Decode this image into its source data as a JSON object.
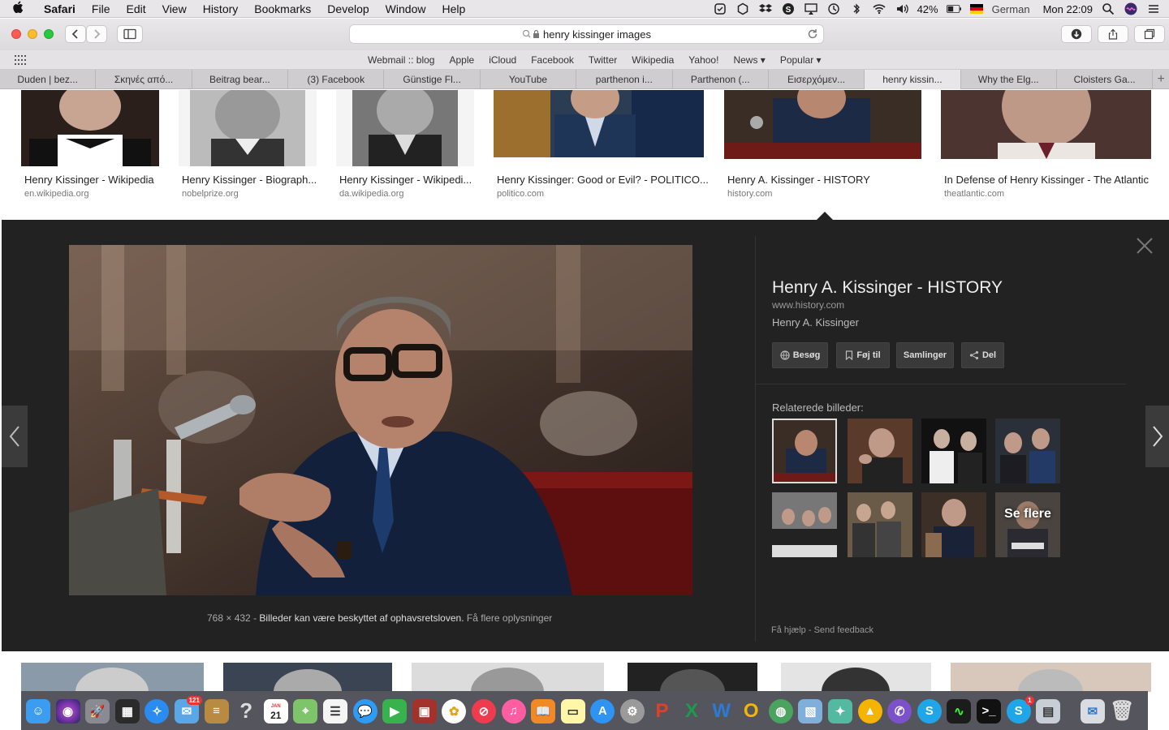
{
  "menubar": {
    "app": "Safari",
    "menus": [
      "File",
      "Edit",
      "View",
      "History",
      "Bookmarks",
      "Develop",
      "Window",
      "Help"
    ],
    "battery": "42%",
    "input_language": "German",
    "clock": "Mon 22:09"
  },
  "toolbar": {
    "address": "henry kissinger images"
  },
  "favorites": [
    "Webmail :: blog",
    "Apple",
    "iCloud",
    "Facebook",
    "Twitter",
    "Wikipedia",
    "Yahoo!",
    "News ▾",
    "Popular ▾"
  ],
  "tabs": [
    "Duden | bez...",
    "Σκηνές από...",
    "Beitrag bear...",
    "(3) Facebook",
    "Günstige Fl...",
    "YouTube",
    "parthenon i...",
    "Parthenon (...",
    "Εισερχόμεν...",
    "henry kissin...",
    "Why the Elg...",
    "Cloisters Ga..."
  ],
  "active_tab_index": 9,
  "results_top": [
    {
      "title": "Henry Kissinger - Wikipedia",
      "source": "en.wikipedia.org"
    },
    {
      "title": "Henry Kissinger - Biograph...",
      "source": "nobelprize.org"
    },
    {
      "title": "Henry Kissinger - Wikipedi...",
      "source": "da.wikipedia.org"
    },
    {
      "title": "Henry Kissinger: Good or Evil? - POLITICO...",
      "source": "politico.com"
    },
    {
      "title": "Henry A. Kissinger - HISTORY",
      "source": "history.com"
    },
    {
      "title": "In Defense of Henry Kissinger - The Atlantic",
      "source": "theatlantic.com"
    }
  ],
  "viewer": {
    "title": "Henry A. Kissinger - HISTORY",
    "url": "www.history.com",
    "subtitle": "Henry A. Kissinger",
    "actions": [
      "Besøg",
      "Føj til",
      "Samlinger",
      "Del"
    ],
    "dimensions": "768 × 432",
    "sep": "-",
    "copyright": "Billeder kan være beskyttet af ophavsretsloven.",
    "more_info": "Få flere oplysninger",
    "related_label": "Relaterede billeder:",
    "see_more": "Se flere",
    "help": "Få hjælp",
    "feedback": "Send feedback"
  },
  "dock_apps": [
    "Finder",
    "Siri",
    "Launchpad",
    "Mission Control",
    "Safari",
    "Mail",
    "Notes",
    "Help",
    "Calendar",
    "Maps",
    "Reminders",
    "Messages",
    "FaceTime",
    "Photo Booth",
    "Photos",
    "News",
    "iTunes",
    "Books",
    "Stickies",
    "App Store",
    "System Preferences",
    "PowerPoint",
    "Excel",
    "Word",
    "Outlook",
    "Internet",
    "Preview",
    "Tools",
    "VLC",
    "Viber",
    "Skype",
    "Activity Monitor",
    "Terminal",
    "Skype",
    "Image Capture",
    "Downloads",
    "Trash"
  ],
  "dock_badges": {
    "mail": "121",
    "calendar_day": "21",
    "calendar_month": "JAN",
    "skype": "1"
  }
}
